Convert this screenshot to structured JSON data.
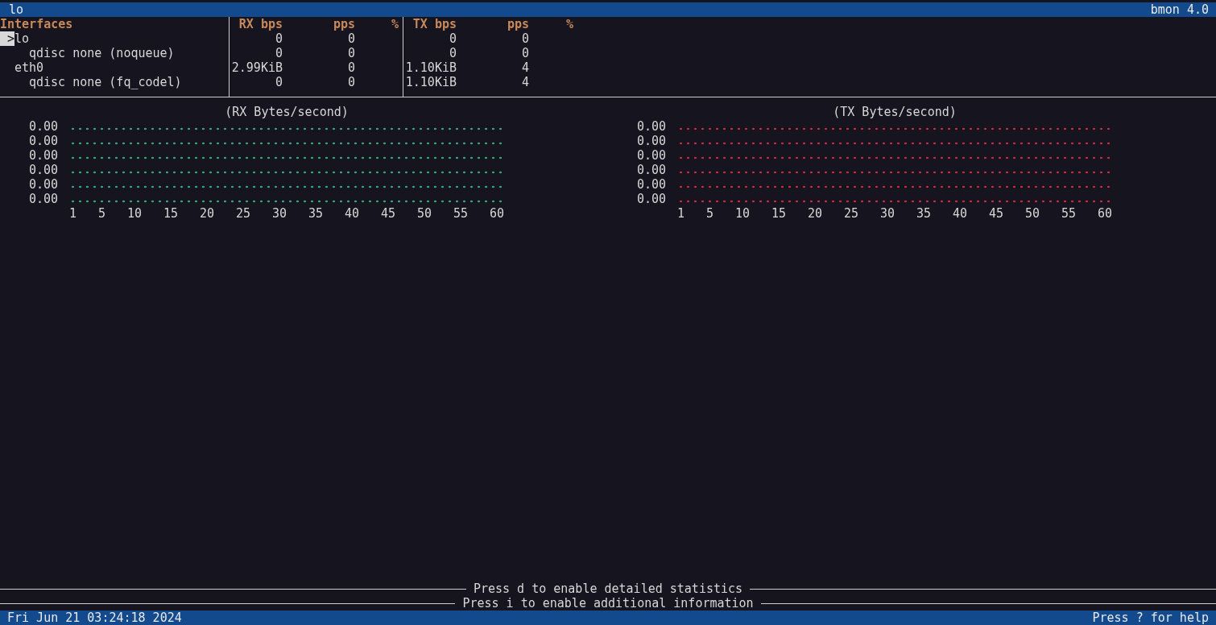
{
  "title_bar": {
    "title": "lo",
    "app": "bmon 4.0"
  },
  "table": {
    "columns": [
      "Interfaces",
      "RX bps",
      "pps",
      "%",
      "TX bps",
      "pps",
      "%"
    ],
    "cursor": ">",
    "rows": [
      {
        "name": "lo",
        "selected": true,
        "rx_bps": "0",
        "rx_pps": "0",
        "tx_bps": "0",
        "tx_pps": "0",
        "children": [
          {
            "name": "qdisc none (noqueue)",
            "selected": false,
            "rx_bps": "0",
            "rx_pps": "0",
            "tx_bps": "0",
            "tx_pps": "0"
          }
        ]
      },
      {
        "name": "eth0",
        "selected": false,
        "rx_bps": "2.99KiB",
        "rx_pps": "0",
        "tx_bps": "1.10KiB",
        "tx_pps": "4",
        "children": [
          {
            "name": "qdisc none (fq_codel)",
            "selected": false,
            "rx_bps": "0",
            "rx_pps": "0",
            "tx_bps": "1.10KiB",
            "tx_pps": "4"
          }
        ]
      }
    ]
  },
  "graphs": [
    {
      "title": "(RX Bytes/second)",
      "color": "#2fa37f",
      "y_labels": [
        "0.00",
        "0.00",
        "0.00",
        "0.00",
        "0.00",
        "0.00"
      ],
      "x_labels": [
        "1",
        "5",
        "10",
        "15",
        "20",
        "25",
        "30",
        "35",
        "40",
        "45",
        "50",
        "55",
        "60"
      ]
    },
    {
      "title": "(TX Bytes/second)",
      "color": "#c8283c",
      "y_labels": [
        "0.00",
        "0.00",
        "0.00",
        "0.00",
        "0.00",
        "0.00"
      ],
      "x_labels": [
        "1",
        "5",
        "10",
        "15",
        "20",
        "25",
        "30",
        "35",
        "40",
        "45",
        "50",
        "55",
        "60"
      ]
    }
  ],
  "hints": [
    "Press d to enable detailed statistics",
    "Press i to enable additional information"
  ],
  "status_bar": {
    "datetime": "Fri Jun 21 03:24:18 2024",
    "help": "Press ? for help"
  }
}
